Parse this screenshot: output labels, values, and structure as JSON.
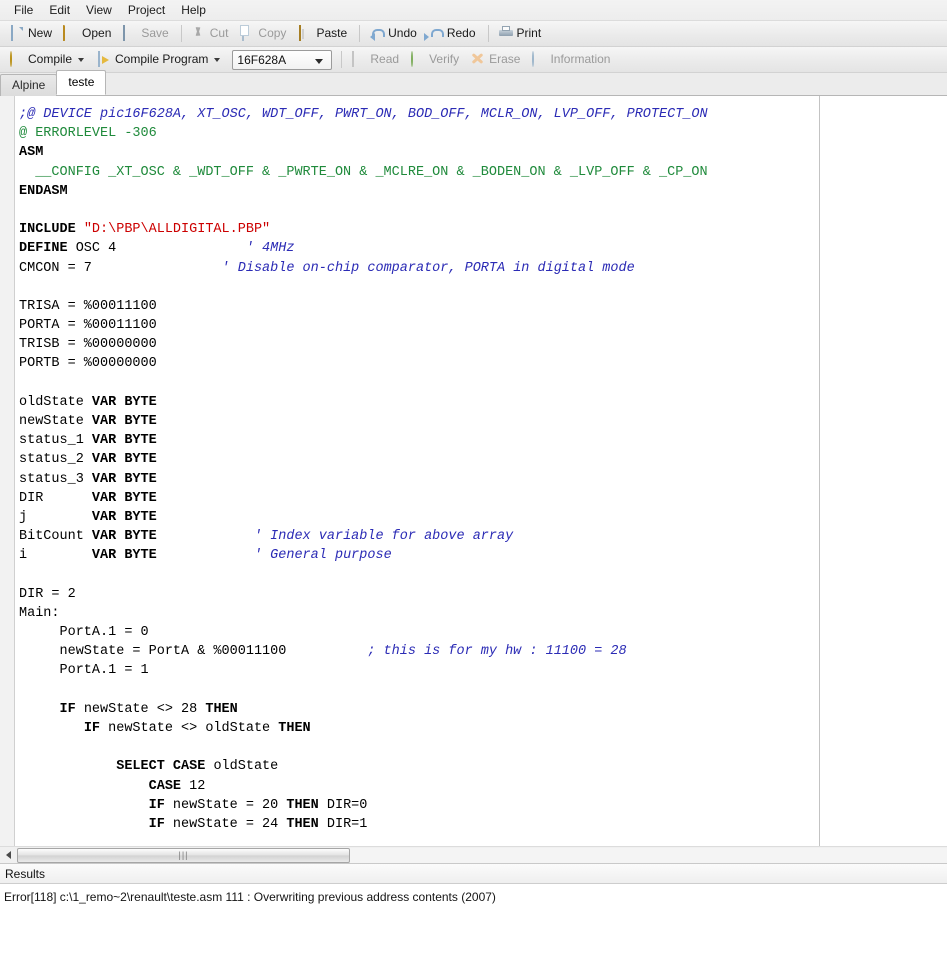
{
  "menubar": {
    "items": [
      {
        "label": "File"
      },
      {
        "label": "Edit"
      },
      {
        "label": "View"
      },
      {
        "label": "Project"
      },
      {
        "label": "Help"
      }
    ]
  },
  "toolbar_main": {
    "buttons": [
      {
        "label": "New",
        "icon": "new-document-icon",
        "enabled": true
      },
      {
        "label": "Open",
        "icon": "open-folder-icon",
        "enabled": true
      },
      {
        "label": "Save",
        "icon": "save-disk-icon",
        "enabled": false
      },
      {
        "label": "Cut",
        "icon": "scissors-icon",
        "enabled": false
      },
      {
        "label": "Copy",
        "icon": "copy-icon",
        "enabled": false
      },
      {
        "label": "Paste",
        "icon": "clipboard-icon",
        "enabled": true
      },
      {
        "label": "Undo",
        "icon": "undo-arrow-icon",
        "enabled": true
      },
      {
        "label": "Redo",
        "icon": "redo-arrow-icon",
        "enabled": true
      },
      {
        "label": "Print",
        "icon": "printer-icon",
        "enabled": true
      }
    ]
  },
  "toolbar_compile": {
    "compile_label": "Compile",
    "compile_icon": "gear-compile-icon",
    "compile_program_label": "Compile Program",
    "compile_program_icon": "compile-program-icon",
    "device_selected": "16F628A",
    "device_options": [
      "16F628A"
    ],
    "read_label": "Read",
    "read_icon": "read-chip-icon",
    "verify_label": "Verify",
    "verify_icon": "verify-check-icon",
    "erase_label": "Erase",
    "erase_icon": "erase-icon",
    "information_label": "Information",
    "information_icon": "information-icon"
  },
  "tabs": [
    {
      "label": "Alpine",
      "active": false
    },
    {
      "label": "teste",
      "active": true
    }
  ],
  "editor": {
    "lines": [
      [
        {
          "t": ";@ DEVICE pic16F628A, XT_OSC, WDT_OFF, PWRT_ON, BOD_OFF, MCLR_ON, LVP_OFF, PROTECT_ON",
          "c": "cmt"
        }
      ],
      [
        {
          "t": "@ ERRORLEVEL -306",
          "c": "grn"
        }
      ],
      [
        {
          "t": "ASM",
          "c": "kw"
        }
      ],
      [
        {
          "t": "  __CONFIG _XT_OSC & _WDT_OFF & _PWRTE_ON & _MCLRE_ON & _BODEN_ON & _LVP_OFF & _CP_ON",
          "c": "grn"
        }
      ],
      [
        {
          "t": "ENDASM",
          "c": "kw"
        }
      ],
      [
        {
          "t": "",
          "c": "pln"
        }
      ],
      [
        {
          "t": "INCLUDE ",
          "c": "kw"
        },
        {
          "t": "\"D:\\PBP\\ALLDIGITAL.PBP\"",
          "c": "str"
        }
      ],
      [
        {
          "t": "DEFINE",
          "c": "kw"
        },
        {
          "t": " OSC 4                ",
          "c": "pln"
        },
        {
          "t": "' 4MHz",
          "c": "cmt"
        }
      ],
      [
        {
          "t": "CMCON = 7                ",
          "c": "pln"
        },
        {
          "t": "' Disable on-chip comparator, PORTA in digital mode",
          "c": "cmt"
        }
      ],
      [
        {
          "t": "",
          "c": "pln"
        }
      ],
      [
        {
          "t": "TRISA = %00011100",
          "c": "pln"
        }
      ],
      [
        {
          "t": "PORTA = %00011100",
          "c": "pln"
        }
      ],
      [
        {
          "t": "TRISB = %00000000",
          "c": "pln"
        }
      ],
      [
        {
          "t": "PORTB = %00000000",
          "c": "pln"
        }
      ],
      [
        {
          "t": "",
          "c": "pln"
        }
      ],
      [
        {
          "t": "oldState ",
          "c": "pln"
        },
        {
          "t": "VAR BYTE",
          "c": "kw"
        }
      ],
      [
        {
          "t": "newState ",
          "c": "pln"
        },
        {
          "t": "VAR BYTE",
          "c": "kw"
        }
      ],
      [
        {
          "t": "status_1 ",
          "c": "pln"
        },
        {
          "t": "VAR BYTE",
          "c": "kw"
        }
      ],
      [
        {
          "t": "status_2 ",
          "c": "pln"
        },
        {
          "t": "VAR BYTE",
          "c": "kw"
        }
      ],
      [
        {
          "t": "status_3 ",
          "c": "pln"
        },
        {
          "t": "VAR BYTE",
          "c": "kw"
        }
      ],
      [
        {
          "t": "DIR      ",
          "c": "pln"
        },
        {
          "t": "VAR BYTE",
          "c": "kw"
        }
      ],
      [
        {
          "t": "j        ",
          "c": "pln"
        },
        {
          "t": "VAR BYTE",
          "c": "kw"
        }
      ],
      [
        {
          "t": "BitCount ",
          "c": "pln"
        },
        {
          "t": "VAR BYTE",
          "c": "kw"
        },
        {
          "t": "            ",
          "c": "pln"
        },
        {
          "t": "' Index variable for above array",
          "c": "cmt"
        }
      ],
      [
        {
          "t": "i        ",
          "c": "pln"
        },
        {
          "t": "VAR BYTE",
          "c": "kw"
        },
        {
          "t": "            ",
          "c": "pln"
        },
        {
          "t": "' General purpose",
          "c": "cmt"
        }
      ],
      [
        {
          "t": "",
          "c": "pln"
        }
      ],
      [
        {
          "t": "DIR = 2",
          "c": "pln"
        }
      ],
      [
        {
          "t": "Main:",
          "c": "pln"
        }
      ],
      [
        {
          "t": "     PortA.1 = 0",
          "c": "pln"
        }
      ],
      [
        {
          "t": "     newState = PortA & %00011100          ",
          "c": "pln"
        },
        {
          "t": "; this is for my hw : 11100 = 28",
          "c": "cmt"
        }
      ],
      [
        {
          "t": "     PortA.1 = 1",
          "c": "pln"
        }
      ],
      [
        {
          "t": "",
          "c": "pln"
        }
      ],
      [
        {
          "t": "     ",
          "c": "pln"
        },
        {
          "t": "IF",
          "c": "kw"
        },
        {
          "t": " newState <> 28 ",
          "c": "pln"
        },
        {
          "t": "THEN",
          "c": "kw"
        }
      ],
      [
        {
          "t": "        ",
          "c": "pln"
        },
        {
          "t": "IF",
          "c": "kw"
        },
        {
          "t": " newState <> oldState ",
          "c": "pln"
        },
        {
          "t": "THEN",
          "c": "kw"
        }
      ],
      [
        {
          "t": "",
          "c": "pln"
        }
      ],
      [
        {
          "t": "            ",
          "c": "pln"
        },
        {
          "t": "SELECT CASE",
          "c": "kw"
        },
        {
          "t": " oldState",
          "c": "pln"
        }
      ],
      [
        {
          "t": "                ",
          "c": "pln"
        },
        {
          "t": "CASE",
          "c": "kw"
        },
        {
          "t": " 12",
          "c": "pln"
        }
      ],
      [
        {
          "t": "                ",
          "c": "pln"
        },
        {
          "t": "IF",
          "c": "kw"
        },
        {
          "t": " newState = 20 ",
          "c": "pln"
        },
        {
          "t": "THEN",
          "c": "kw"
        },
        {
          "t": " DIR=0",
          "c": "pln"
        }
      ],
      [
        {
          "t": "                ",
          "c": "pln"
        },
        {
          "t": "IF",
          "c": "kw"
        },
        {
          "t": " newState = 24 ",
          "c": "pln"
        },
        {
          "t": "THEN",
          "c": "kw"
        },
        {
          "t": " DIR=1",
          "c": "pln"
        }
      ]
    ]
  },
  "hscrollbar": {
    "left_arrow_icon": "triangle-left-icon",
    "grip_glyph": "|||"
  },
  "results": {
    "header": "Results",
    "messages": [
      "Error[118] c:\\1_remo~2\\renault\\teste.asm 111 : Overwriting previous address contents (2007)"
    ]
  },
  "colors": {
    "comment": "#2b2bb5",
    "string": "#cc0000",
    "directive": "#1f8a3b",
    "keyword": "#000000",
    "editor_bg": "#ffffff",
    "chrome_bg": "#ececec"
  }
}
